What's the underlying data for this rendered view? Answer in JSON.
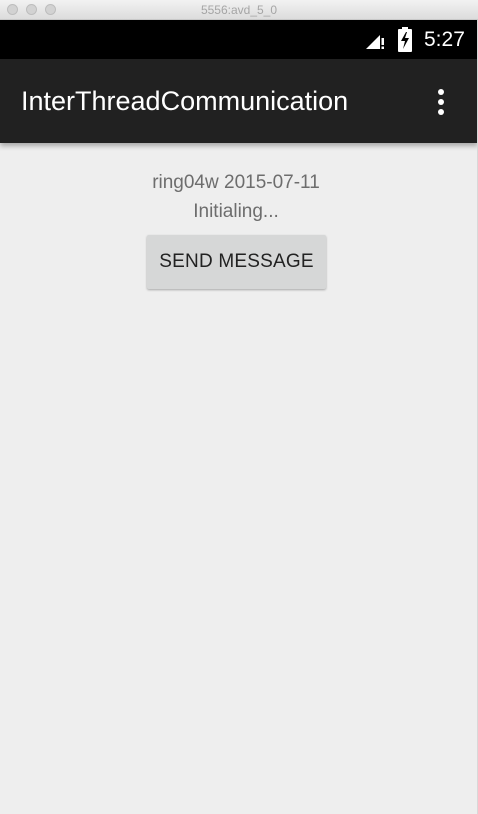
{
  "window": {
    "title": "5556:avd_5_0"
  },
  "status_bar": {
    "time": "5:27",
    "signal_icon": "signal-no-connection-icon",
    "battery_icon": "battery-charging-icon"
  },
  "app_bar": {
    "title": "InterThreadCommunication",
    "overflow_icon": "more-vertical-icon",
    "background_color": "#212121"
  },
  "main": {
    "author_line": "ring04w 2015-07-11",
    "status_line": "Initialing...",
    "send_button_label": "SEND MESSAGE"
  }
}
